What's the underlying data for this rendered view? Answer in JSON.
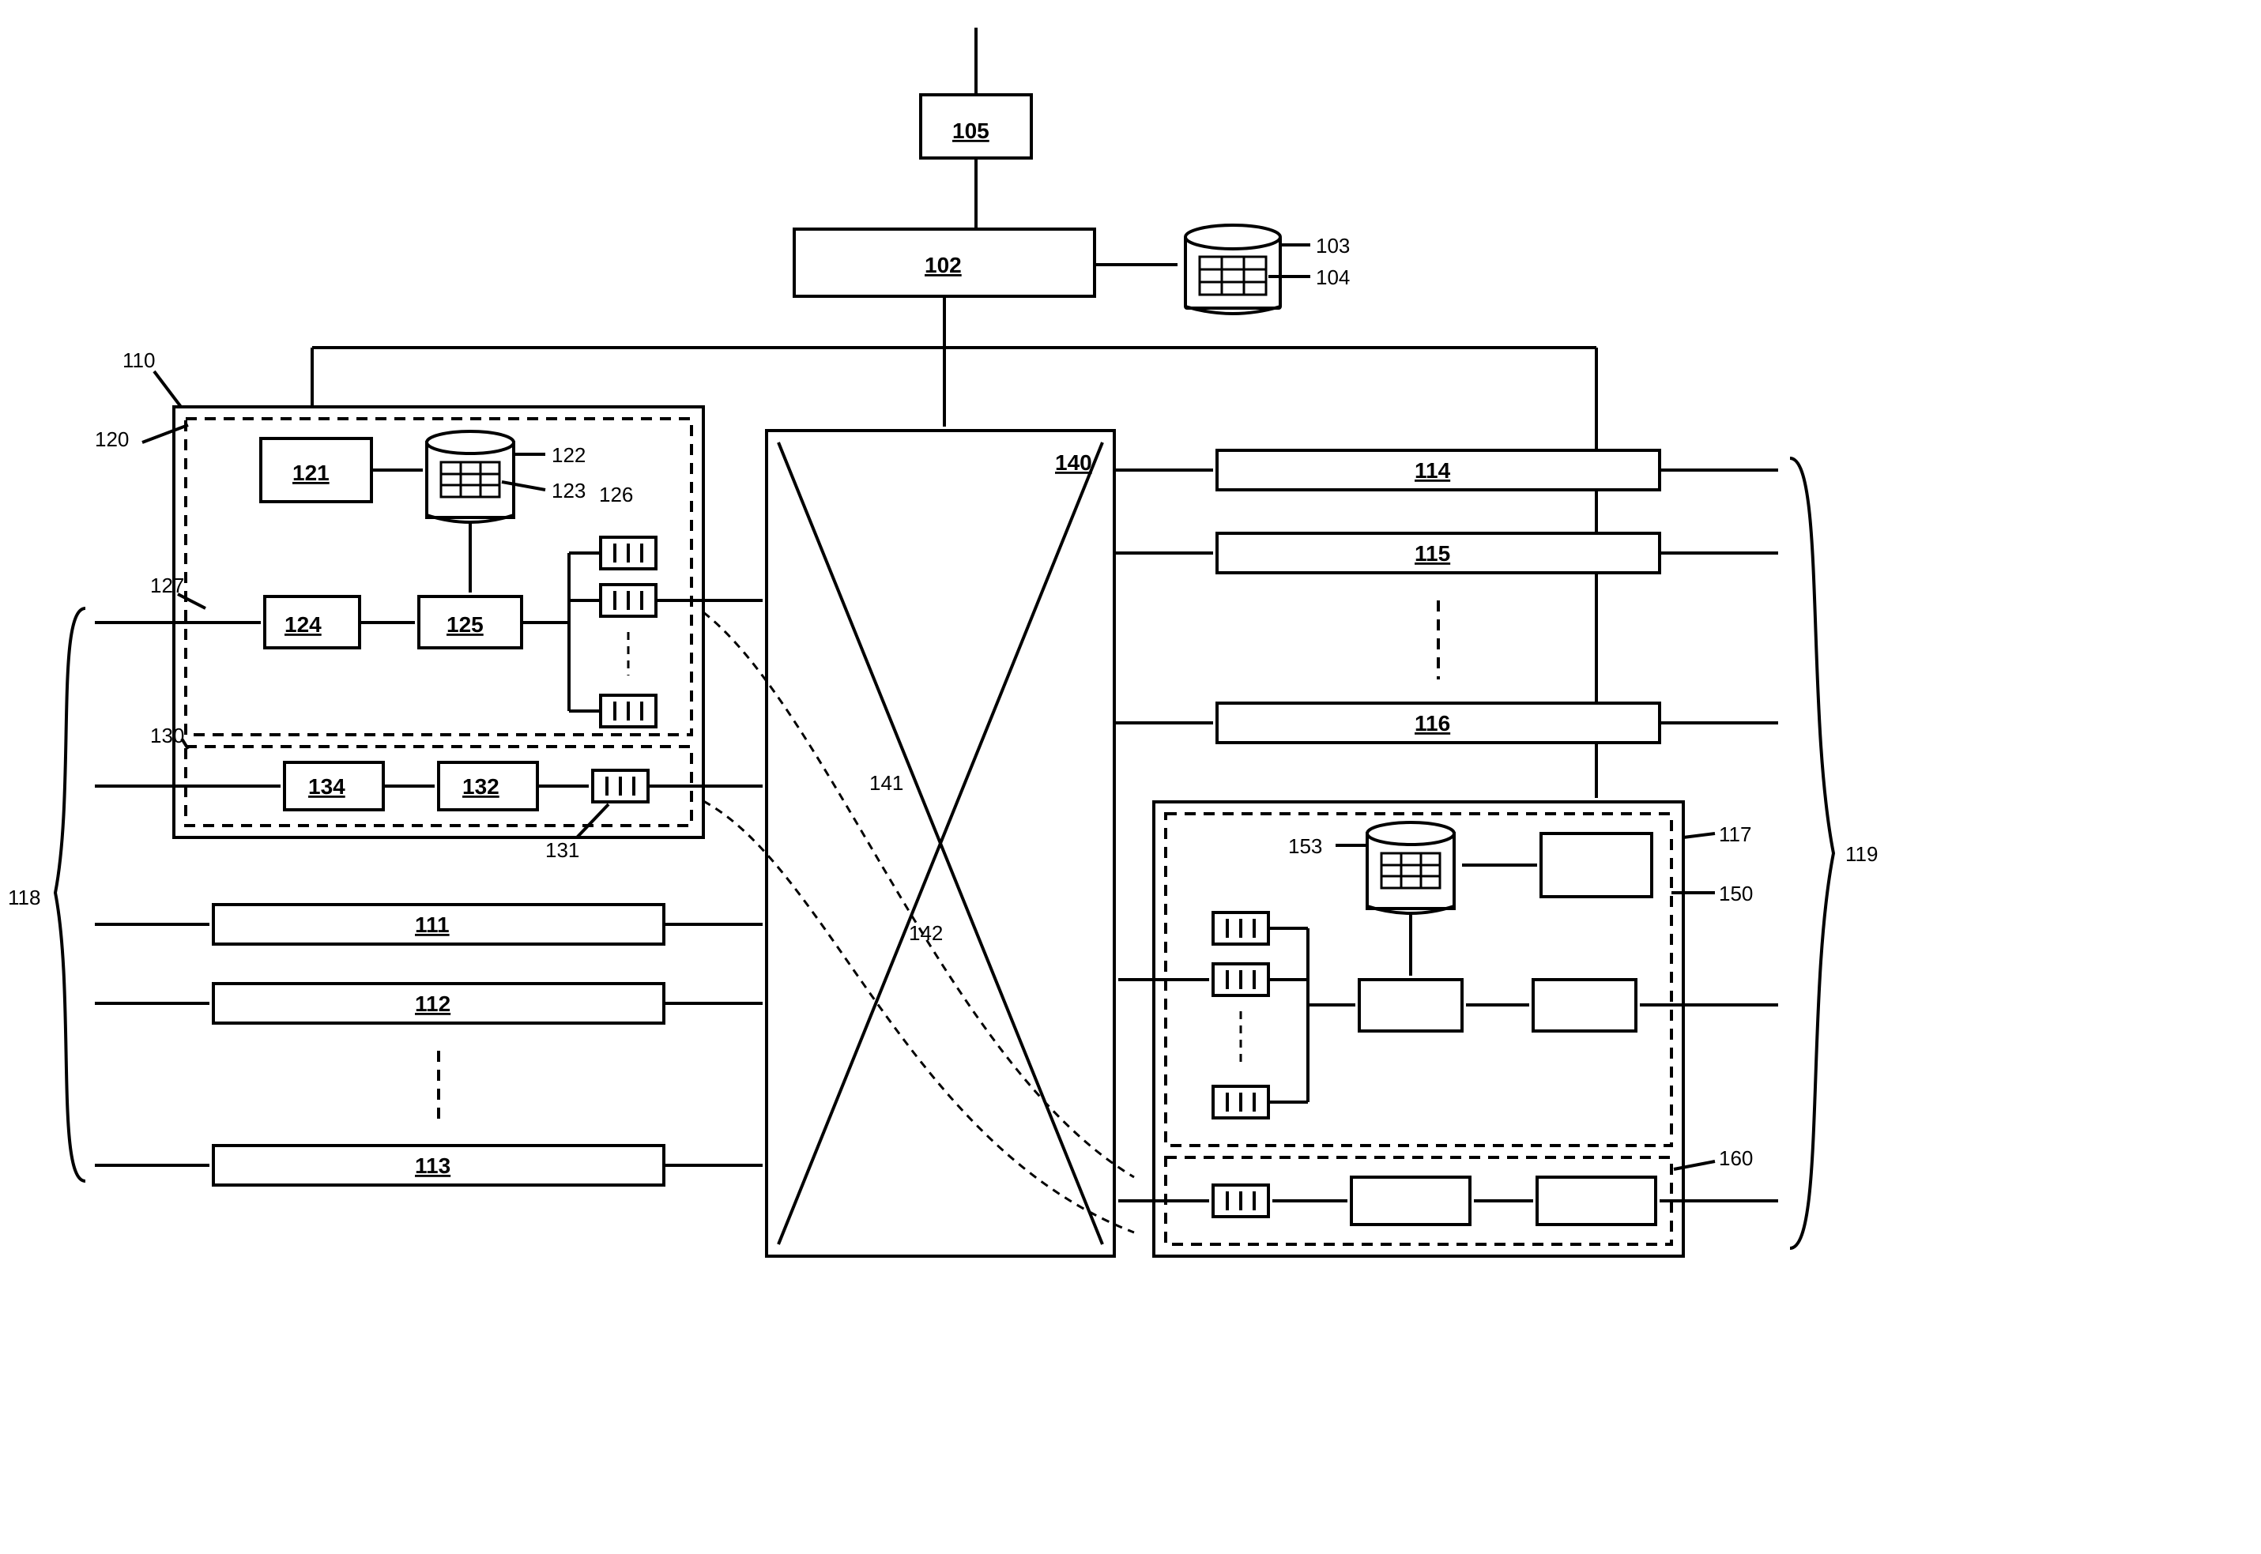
{
  "refs": {
    "r105": "105",
    "r102": "102",
    "r103": "103",
    "r104": "104",
    "r110": "110",
    "r120": "120",
    "r121": "121",
    "r122": "122",
    "r123": "123",
    "r124": "124",
    "r125": "125",
    "r126": "126",
    "r127": "127",
    "r130": "130",
    "r131": "131",
    "r132": "132",
    "r134": "134",
    "r111": "111",
    "r112": "112",
    "r113": "113",
    "r118": "118",
    "r140": "140",
    "r141": "141",
    "r142": "142",
    "r114": "114",
    "r115": "115",
    "r116": "116",
    "r117": "117",
    "r119": "119",
    "r150": "150",
    "r153": "153",
    "r160": "160"
  }
}
